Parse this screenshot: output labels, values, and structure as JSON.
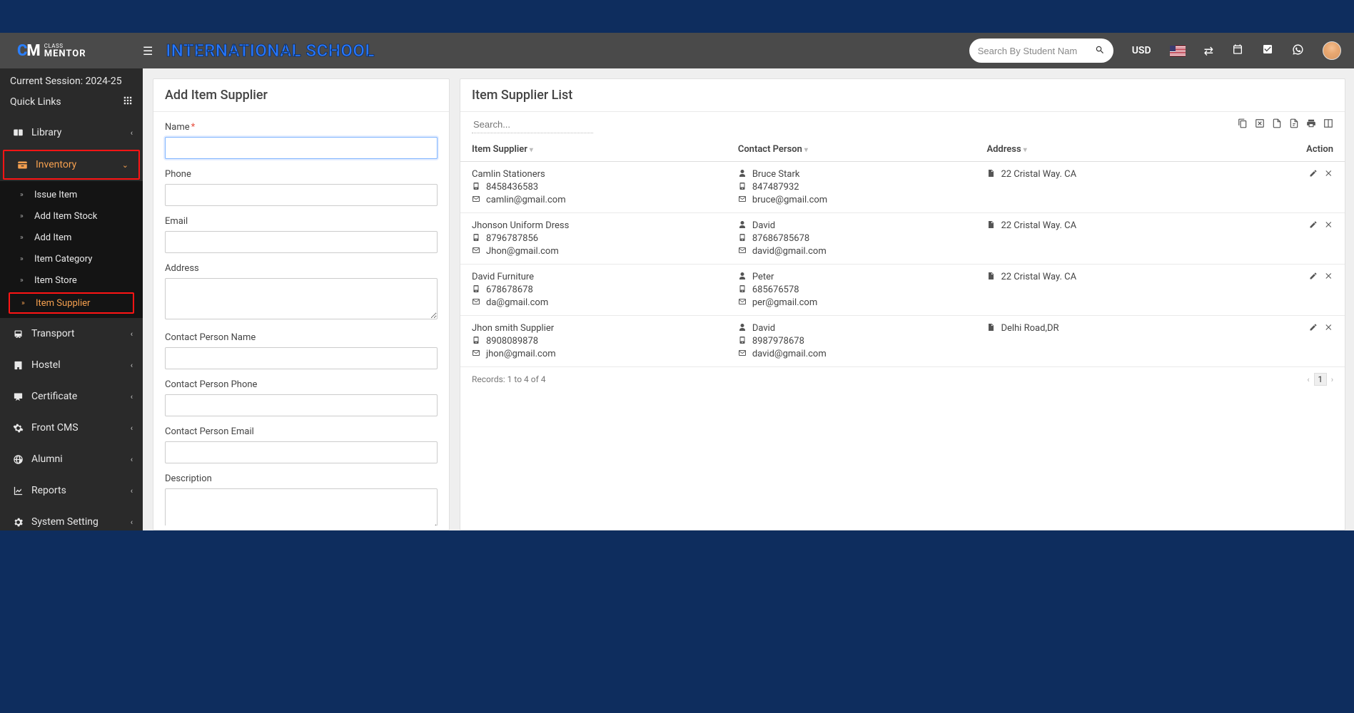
{
  "header": {
    "school_title": "INTERNATIONAL SCHOOL",
    "search_placeholder": "Search By Student Nam",
    "currency": "USD"
  },
  "sidebar": {
    "session_label": "Current Session: 2024-25",
    "quick_links": "Quick Links",
    "items": {
      "library": "Library",
      "inventory": "Inventory",
      "transport": "Transport",
      "hostel": "Hostel",
      "certificate": "Certificate",
      "front_cms": "Front CMS",
      "alumni": "Alumni",
      "reports": "Reports",
      "system_setting": "System Setting"
    },
    "inventory_subs": {
      "issue_item": "Issue Item",
      "add_item_stock": "Add Item Stock",
      "add_item": "Add Item",
      "item_category": "Item Category",
      "item_store": "Item Store",
      "item_supplier": "Item Supplier"
    }
  },
  "form": {
    "title": "Add Item Supplier",
    "labels": {
      "name": "Name",
      "phone": "Phone",
      "email": "Email",
      "address": "Address",
      "cp_name": "Contact Person Name",
      "cp_phone": "Contact Person Phone",
      "cp_email": "Contact Person Email",
      "description": "Description"
    }
  },
  "list": {
    "title": "Item Supplier List",
    "search_placeholder": "Search...",
    "columns": {
      "supplier": "Item Supplier",
      "contact": "Contact Person",
      "address": "Address",
      "action": "Action"
    },
    "rows": [
      {
        "supplier_name": "Camlin Stationers",
        "supplier_phone": "8458436583",
        "supplier_email": "camlin@gmail.com",
        "contact_name": "Bruce Stark",
        "contact_phone": "847487932",
        "contact_email": "bruce@gmail.com",
        "address": "22 Cristal Way. CA"
      },
      {
        "supplier_name": "Jhonson Uniform Dress",
        "supplier_phone": "8796787856",
        "supplier_email": "Jhon@gmail.com",
        "contact_name": "David",
        "contact_phone": "87686785678",
        "contact_email": "david@gmail.com",
        "address": "22 Cristal Way. CA"
      },
      {
        "supplier_name": "David Furniture",
        "supplier_phone": "678678678",
        "supplier_email": "da@gmail.com",
        "contact_name": "Peter",
        "contact_phone": "685676578",
        "contact_email": "per@gmail.com",
        "address": "22 Cristal Way. CA"
      },
      {
        "supplier_name": "Jhon smith Supplier",
        "supplier_phone": "8908089878",
        "supplier_email": "jhon@gmail.com",
        "contact_name": "David",
        "contact_phone": "8987978678",
        "contact_email": "david@gmail.com",
        "address": "Delhi Road,DR"
      }
    ],
    "records_text": "Records: 1 to 4 of 4",
    "page": "1"
  }
}
